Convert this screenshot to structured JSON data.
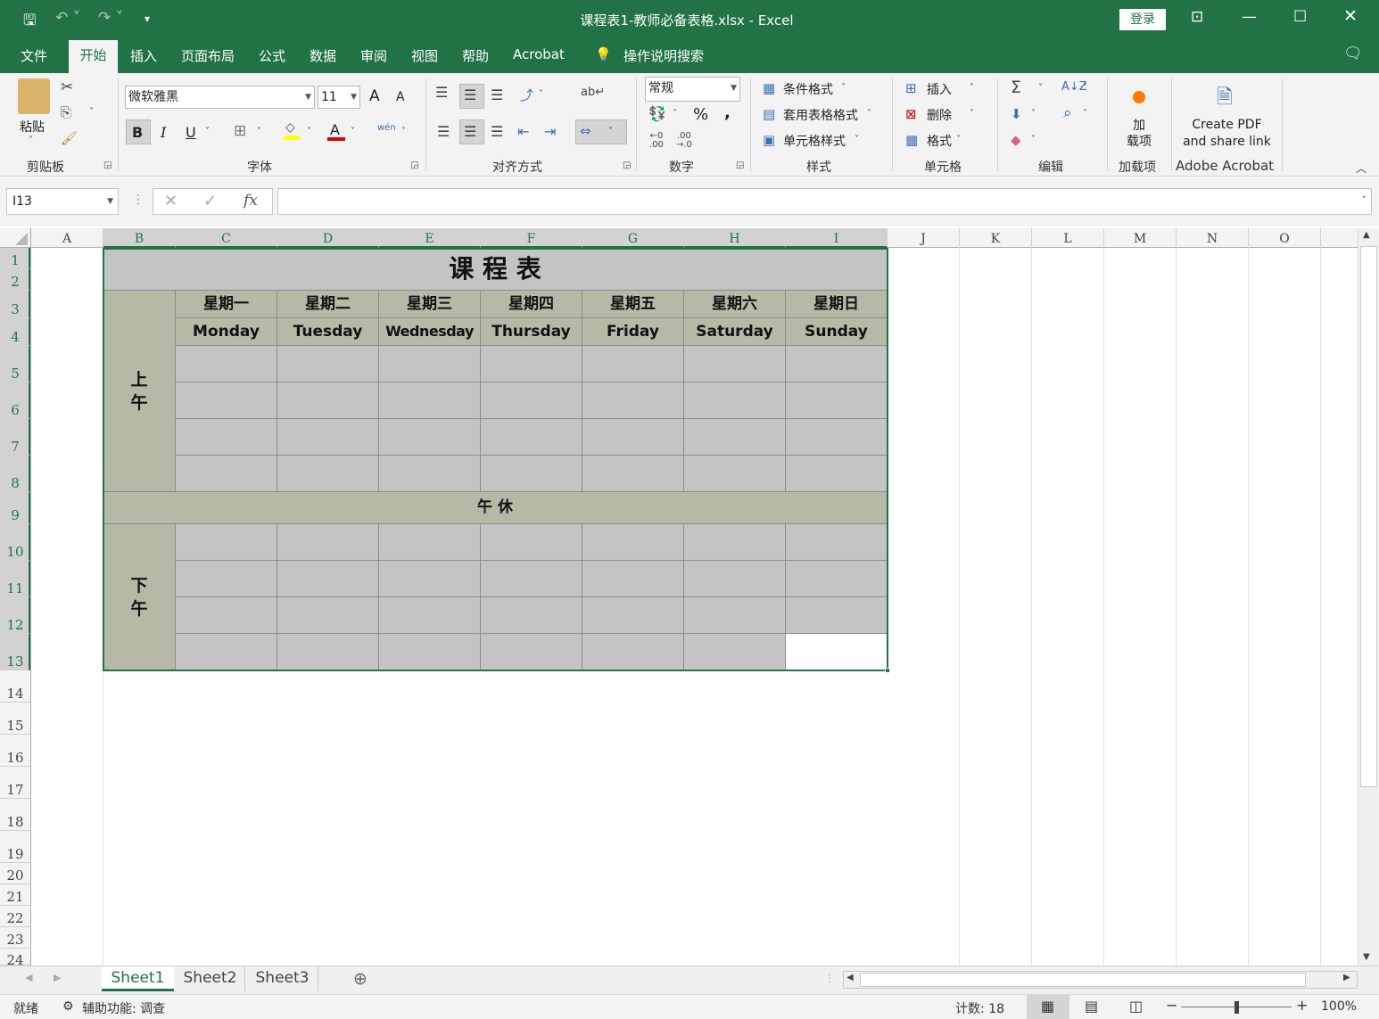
{
  "window": {
    "title": "课程表1-教师必备表格.xlsx  -  Excel",
    "login": "登录"
  },
  "menu": {
    "tabs": [
      "文件",
      "开始",
      "插入",
      "页面布局",
      "公式",
      "数据",
      "审阅",
      "视图",
      "帮助",
      "Acrobat"
    ],
    "active": "开始",
    "search": "操作说明搜索"
  },
  "ribbon": {
    "clipboard": {
      "paste": "粘贴",
      "label": "剪贴板"
    },
    "font": {
      "name": "微软雅黑",
      "size": "11",
      "label": "字体",
      "grow": "A",
      "shrink": "A",
      "bold": "B",
      "italic": "I",
      "underline": "U",
      "font_color": "A",
      "phonetic": "wén"
    },
    "alignment": {
      "label": "对齐方式"
    },
    "number": {
      "format": "常规",
      "label": "数字",
      "percent": "%",
      "comma": ","
    },
    "styles": {
      "conditional": "条件格式",
      "table": "套用表格格式",
      "cell": "单元格样式",
      "label": "样式"
    },
    "cells": {
      "insert": "插入",
      "delete": "删除",
      "format": "格式",
      "label": "单元格"
    },
    "editing": {
      "label": "编辑"
    },
    "addins": {
      "button": "加\n载项",
      "label": "加载项"
    },
    "acrobat": {
      "button_line1": "Create PDF",
      "button_line2": "and share link",
      "label": "Adobe Acrobat"
    }
  },
  "formula_bar": {
    "name_box": "I13",
    "value": "",
    "fx": "fx"
  },
  "columns": [
    "A",
    "B",
    "C",
    "D",
    "E",
    "F",
    "G",
    "H",
    "I",
    "J",
    "K",
    "L",
    "M",
    "N",
    "O"
  ],
  "rows": [
    "1",
    "2",
    "3",
    "4",
    "5",
    "6",
    "7",
    "8",
    "9",
    "10",
    "11",
    "12",
    "13",
    "14",
    "15",
    "16",
    "17",
    "18",
    "19",
    "20",
    "21",
    "22",
    "23",
    "24"
  ],
  "schedule": {
    "title": "课 程 表",
    "morning": "上\n午",
    "noon": "午 休",
    "afternoon": "下\n午",
    "days_cn": [
      "星期一",
      "星期二",
      "星期三",
      "星期四",
      "星期五",
      "星期六",
      "星期日"
    ],
    "days_en": [
      "Monday",
      "Tuesday",
      "Wednesday",
      "Thursday",
      "Friday",
      "Saturday",
      "Sunday"
    ]
  },
  "sheets": [
    "Sheet1",
    "Sheet2",
    "Sheet3"
  ],
  "active_sheet": "Sheet1",
  "status": {
    "ready": "就绪",
    "accessibility": "辅助功能: 调查",
    "count": "计数: 18",
    "zoom": "100%"
  },
  "colors": {
    "excel_green": "#217346",
    "cell_gray": "#c4c4c4",
    "header_green": "#b5b9a6"
  }
}
